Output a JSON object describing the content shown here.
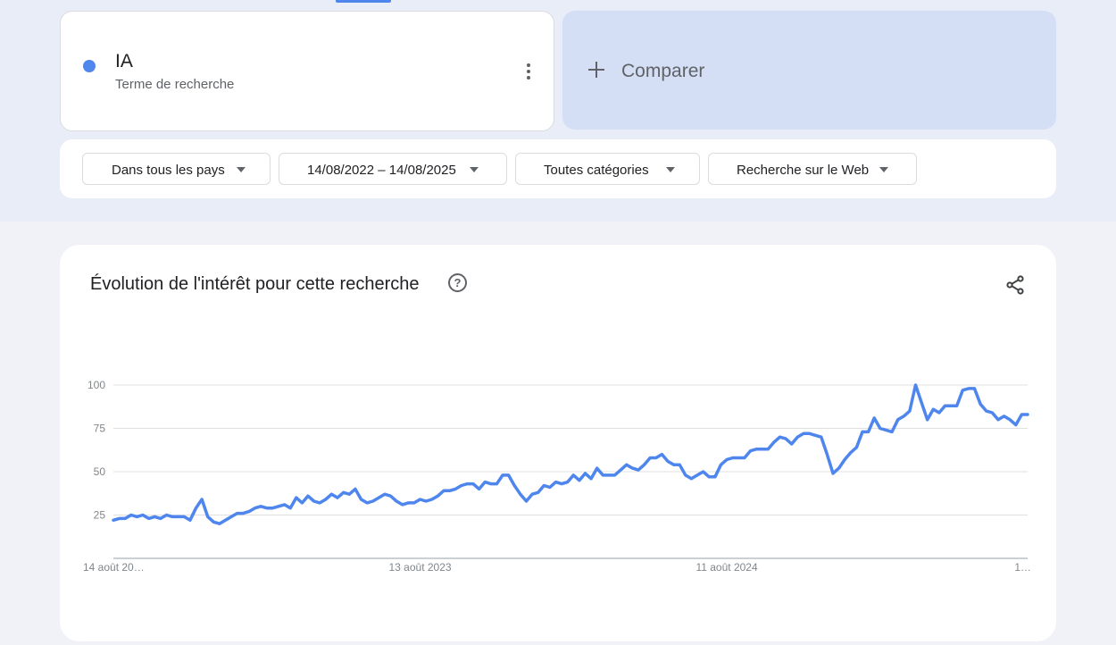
{
  "search_term": {
    "name": "IA",
    "subtitle": "Terme de recherche",
    "color": "#4e86ee",
    "more_icon": "more-vert-icon"
  },
  "compare": {
    "label": "Comparer",
    "icon": "plus-icon"
  },
  "filters": [
    {
      "label": "Dans tous les pays"
    },
    {
      "label": "14/08/2022 – 14/08/2025"
    },
    {
      "label": "Toutes catégories"
    },
    {
      "label": "Recherche sur le Web"
    }
  ],
  "interest_panel": {
    "title": "Évolution de l'intérêt pour cette recherche",
    "help_icon": "help-circle-icon",
    "share_icon": "share-icon"
  },
  "chart_data": {
    "type": "line",
    "y_ticks": [
      25,
      50,
      75,
      100
    ],
    "ylim": [
      0,
      100
    ],
    "x_tick_labels": [
      {
        "label": "14 août 20…",
        "index": 0
      },
      {
        "label": "13 août 2023",
        "index": 52
      },
      {
        "label": "11 août 2024",
        "index": 104
      },
      {
        "label": "1…",
        "index": 156
      }
    ],
    "grid": true,
    "series": [
      {
        "color": "#4e86ee",
        "values": [
          22,
          23,
          23,
          25,
          24,
          25,
          23,
          24,
          23,
          25,
          24,
          24,
          24,
          22,
          29,
          34,
          24,
          21,
          20,
          22,
          24,
          26,
          26,
          27,
          29,
          30,
          29,
          29,
          30,
          31,
          29,
          35,
          32,
          36,
          33,
          32,
          34,
          37,
          35,
          38,
          37,
          40,
          34,
          32,
          33,
          35,
          37,
          36,
          33,
          31,
          32,
          32,
          34,
          33,
          34,
          36,
          39,
          39,
          40,
          42,
          43,
          43,
          40,
          44,
          43,
          43,
          48,
          48,
          42,
          37,
          33,
          37,
          38,
          42,
          41,
          44,
          43,
          44,
          48,
          45,
          49,
          46,
          52,
          48,
          48,
          48,
          51,
          54,
          52,
          51,
          54,
          58,
          58,
          60,
          56,
          54,
          54,
          48,
          46,
          48,
          50,
          47,
          47,
          54,
          57,
          58,
          58,
          58,
          62,
          63,
          63,
          63,
          67,
          70,
          69,
          66,
          70,
          72,
          72,
          71,
          70,
          60,
          49,
          52,
          57,
          61,
          64,
          73,
          73,
          81,
          75,
          74,
          73,
          80,
          82,
          85,
          100,
          90,
          80,
          86,
          84,
          88,
          88,
          88,
          97,
          98,
          98,
          89,
          85,
          84,
          80,
          82,
          80,
          77,
          83,
          83
        ]
      }
    ]
  }
}
